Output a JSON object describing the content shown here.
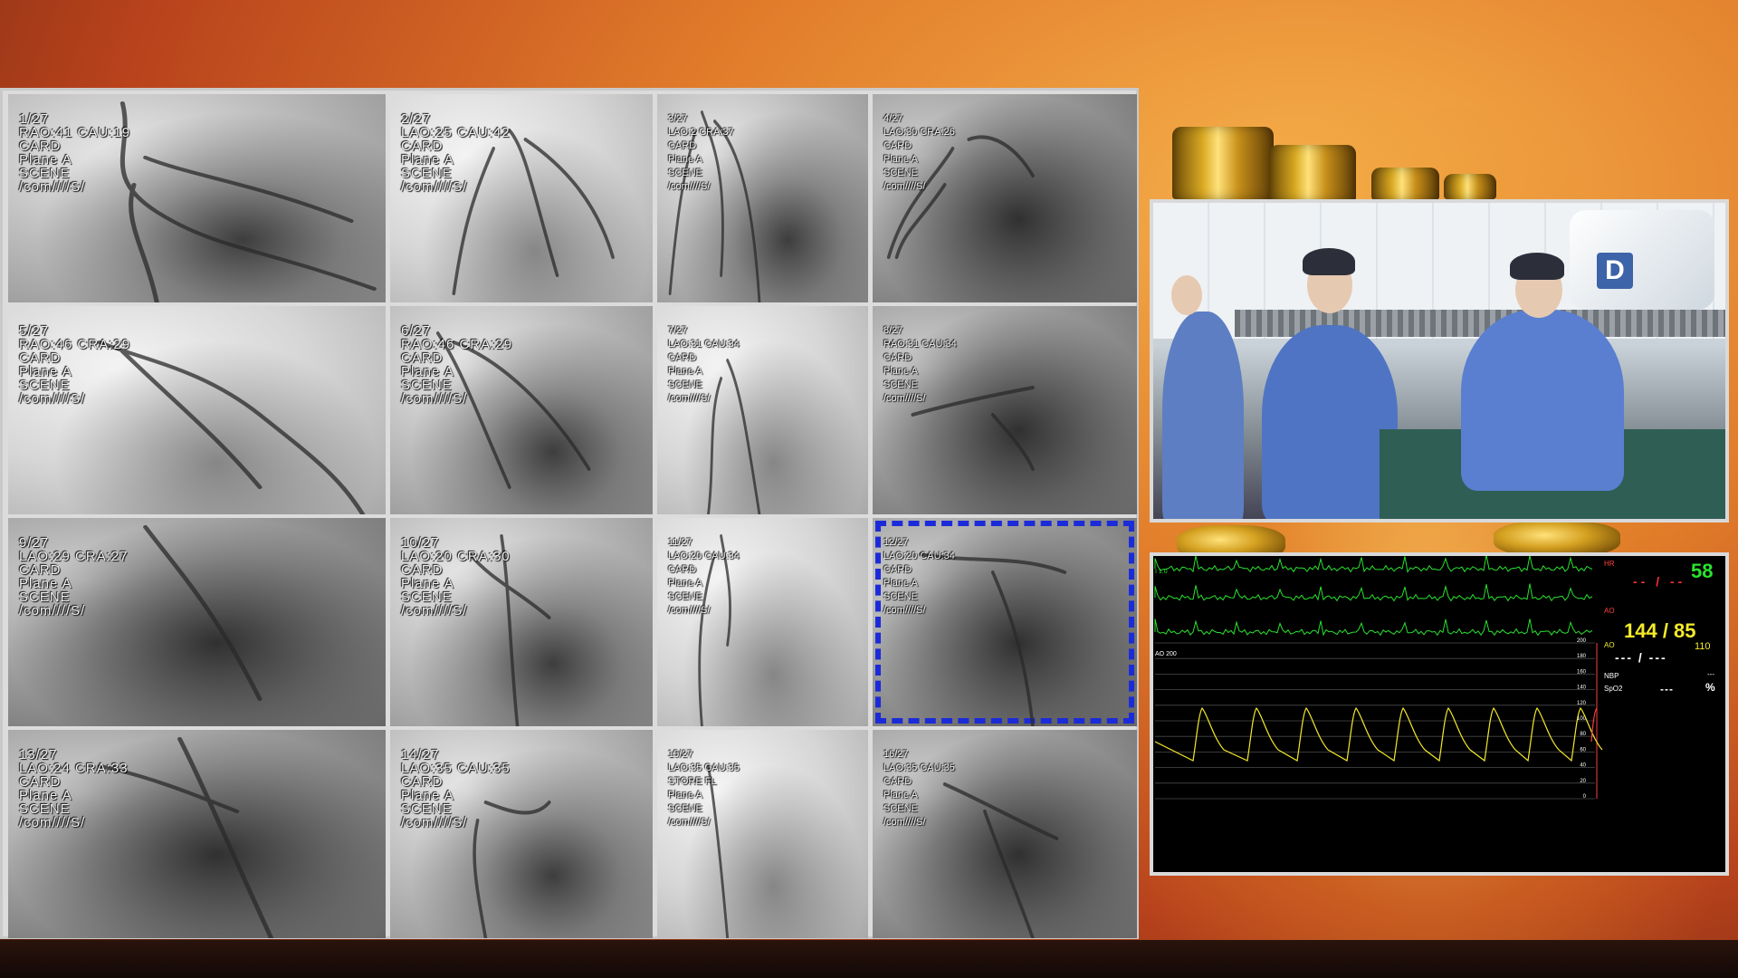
{
  "angiography": {
    "tiles": [
      {
        "frame": "1/27",
        "angle": "RAO:41 CAU:19",
        "mode": "CARD",
        "plane": "Plane A",
        "scene": "SCENE",
        "path": "/com////S/"
      },
      {
        "frame": "2/27",
        "angle": "LAO:25 CAU:42",
        "mode": "CARD",
        "plane": "Plane A",
        "scene": "SCENE",
        "path": "/com////S/"
      },
      {
        "frame": "3/27",
        "angle": "LAO:2 CRA:37",
        "mode": "CARD",
        "plane": "Plane A",
        "scene": "SCENE",
        "path": "/com////S/"
      },
      {
        "frame": "4/27",
        "angle": "LAO:30 CRA:26",
        "mode": "CARD",
        "plane": "Plane A",
        "scene": "SCENE",
        "path": "/com////S/"
      },
      {
        "frame": "5/27",
        "angle": "RAO:46 CRA:29",
        "mode": "CARD",
        "plane": "Plane A",
        "scene": "SCENE",
        "path": "/com////S/"
      },
      {
        "frame": "6/27",
        "angle": "RAO:46 CRA:29",
        "mode": "CARD",
        "plane": "Plane A",
        "scene": "SCENE",
        "path": "/com////S/"
      },
      {
        "frame": "7/27",
        "angle": "LAO:31 CAU:34",
        "mode": "CARD",
        "plane": "Plane A",
        "scene": "SCENE",
        "path": "/com////S/"
      },
      {
        "frame": "8/27",
        "angle": "RAO:31 CAU:34",
        "mode": "CARD",
        "plane": "Plane A",
        "scene": "SCENE",
        "path": "/com////S/"
      },
      {
        "frame": "9/27",
        "angle": "LAO:29 CRA:27",
        "mode": "CARD",
        "plane": "Plane A",
        "scene": "SCENE",
        "path": "/com////S/"
      },
      {
        "frame": "10/27",
        "angle": "LAO:20 CRA:30",
        "mode": "CARD",
        "plane": "Plane A",
        "scene": "SCENE",
        "path": "/com////S/"
      },
      {
        "frame": "11/27",
        "angle": "LAO:20 CAU:34",
        "mode": "CARD",
        "plane": "Plane A",
        "scene": "SCENE",
        "path": "/com////S/"
      },
      {
        "frame": "12/27",
        "angle": "LAO:20 CAU:34",
        "mode": "CARD",
        "plane": "Plane A",
        "scene": "SCENE",
        "path": "/com////S/"
      },
      {
        "frame": "13/27",
        "angle": "LAO:24 CRA:33",
        "mode": "CARD",
        "plane": "Plane A",
        "scene": "SCENE",
        "path": "/com////S/"
      },
      {
        "frame": "14/27",
        "angle": "LAO:35 CAU:35",
        "mode": "CARD",
        "plane": "Plane A",
        "scene": "SCENE",
        "path": "/com////S/"
      },
      {
        "frame": "15/27",
        "angle": "LAO:35 CAU:35",
        "mode": "STORE FL",
        "plane": "Plane A",
        "scene": "SCENE",
        "path": "/com////S/"
      },
      {
        "frame": "16/27",
        "angle": "LAO:35 CAU:35",
        "mode": "CARD",
        "plane": "Plane A",
        "scene": "SCENE",
        "path": "/com////S/"
      }
    ]
  },
  "camera": {
    "letter": "D"
  },
  "monitor": {
    "hr_label": "HR",
    "hr_value": "58",
    "lead_label": "I   1.0",
    "red_dashes": "-- / --",
    "ao_red_label": "AO",
    "bp_value": "144 / 85",
    "ao_label": "AO",
    "bp_mean": "110",
    "white_dashes": "--- /   ---",
    "nbp_label": "NBP",
    "nbp_value": "---",
    "spo2_label": "SpO2",
    "spo2_value": "---",
    "spo2_unit": "%",
    "ao_scale_label": "AO",
    "ao_scale_value": "200",
    "scale_ticks": [
      "200",
      "180",
      "160",
      "140",
      "120",
      "100",
      "80",
      "60",
      "40",
      "20",
      "0"
    ],
    "colors": {
      "ecg": "#29e22d",
      "pressure": "#f4ea2a",
      "alarm": "#ff4040"
    }
  }
}
